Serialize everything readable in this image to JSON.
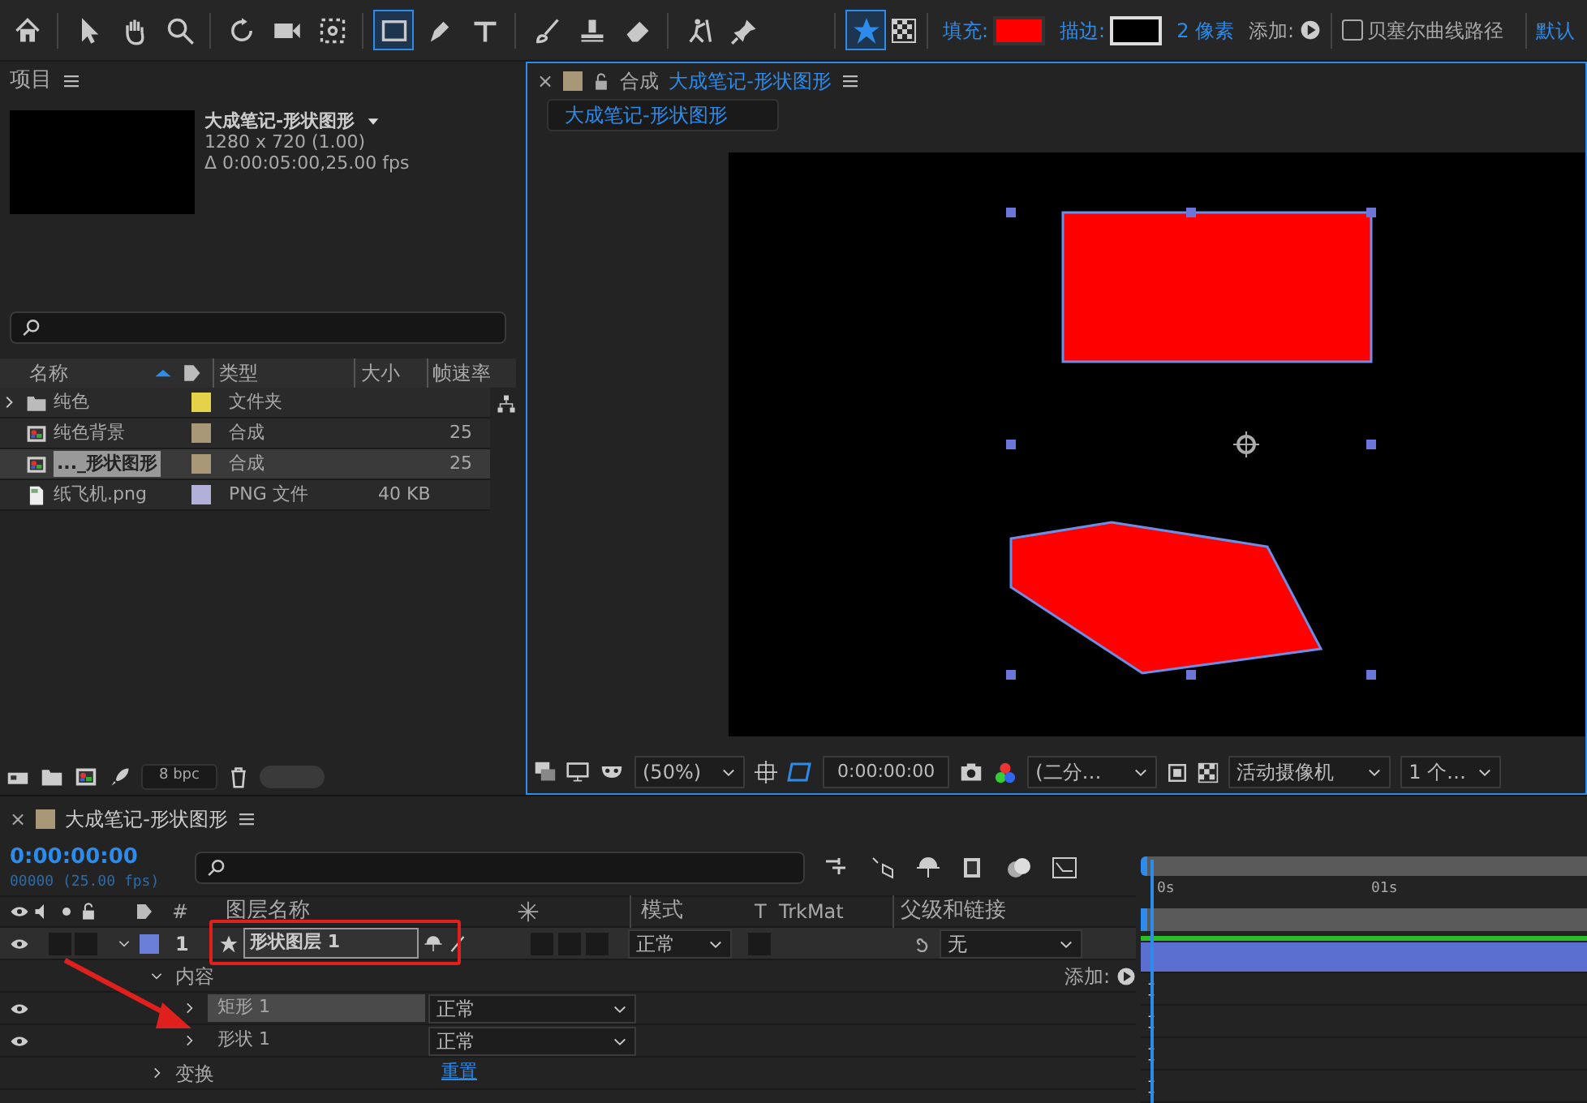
{
  "toolbar": {
    "tools": [
      {
        "kind": "home",
        "selected": false
      },
      {
        "kind": "select",
        "selected": false
      },
      {
        "kind": "hand",
        "selected": false
      },
      {
        "kind": "zoom",
        "selected": false
      },
      {
        "kind": "rotate",
        "selected": false
      },
      {
        "kind": "camera",
        "selected": false
      },
      {
        "kind": "pan",
        "selected": false
      },
      {
        "kind": "rect",
        "selected": true
      },
      {
        "kind": "pen",
        "selected": false
      },
      {
        "kind": "text",
        "selected": false
      },
      {
        "kind": "brush",
        "selected": false
      },
      {
        "kind": "stamp",
        "selected": false
      },
      {
        "kind": "eraser",
        "selected": false
      },
      {
        "kind": "puppet",
        "selected": false
      },
      {
        "kind": "pin",
        "selected": false
      }
    ],
    "star_selected": true,
    "fill": {
      "label": "填充:",
      "color": "#ff0000"
    },
    "stroke": {
      "label": "描边:",
      "color": "#000000"
    },
    "stroke_width": "2 像素",
    "add_label": "添加:",
    "bezier": {
      "label": "贝塞尔曲线路径",
      "checked": false
    },
    "workspace": "默认"
  },
  "project": {
    "title": "项目",
    "preview": {
      "name": "大成笔记-形状图形",
      "size": "1280 x 720 (1.00)",
      "duration": "Δ 0:00:05:00,25.00 fps"
    },
    "columns": [
      "名称",
      "类型",
      "大小",
      "帧速率"
    ],
    "items": [
      {
        "kind": "folder",
        "name": "纯色",
        "type": "文件夹",
        "color": "#e6d24a",
        "selected": false
      },
      {
        "kind": "comp",
        "name": "纯色背景",
        "type": "合成",
        "fps": "25",
        "color": "#a89878",
        "selected": false
      },
      {
        "kind": "comp",
        "name": "..._形状图形",
        "type": "合成",
        "fps": "25",
        "color": "#a89878",
        "selected": true
      },
      {
        "kind": "file",
        "name": "纸飞机.png",
        "type": "PNG 文件",
        "size": "40 KB",
        "color": "#b0b0d8",
        "selected": false
      }
    ],
    "bpc": "8 bpc",
    "thumbnail_slider": {
      "level": 1
    }
  },
  "viewer": {
    "close": "×",
    "tab_prefix": "合成",
    "tab_name": "大成笔记-形状图形",
    "breadcrumb": "大成笔记-形状图形",
    "zoom": "(50%)",
    "timecode": "0:00:00:00",
    "resolution": "(二分…",
    "camera": "活动摄像机",
    "views": "1 个…"
  },
  "timeline": {
    "close": "×",
    "tab": "大成笔记-形状图形",
    "timecode": "0:00:00:00",
    "frames": "00000 (25.00 fps)",
    "columns": {
      "number": "#",
      "name": "图层名称",
      "mode": "模式",
      "t": "T",
      "trkmat": "TrkMat",
      "parent": "父级和链接"
    },
    "layers": [
      {
        "number": "1",
        "name": "形状图层 1",
        "mode": "正常",
        "parent": "无",
        "solo": false,
        "locked": false,
        "expanded": true,
        "highlighted": true,
        "children": [
          {
            "name": "内容",
            "expanded": true,
            "action_label": "添加:",
            "children": [
              {
                "name": "矩形 1",
                "mode": "正常",
                "expanded": false,
                "selected": true
              },
              {
                "name": "形状 1",
                "mode": "正常",
                "expanded": false,
                "selected": false
              }
            ]
          },
          {
            "name": "变换",
            "expanded": false,
            "reset": "重置"
          }
        ]
      }
    ],
    "ruler": [
      "0s",
      "01s"
    ]
  }
}
